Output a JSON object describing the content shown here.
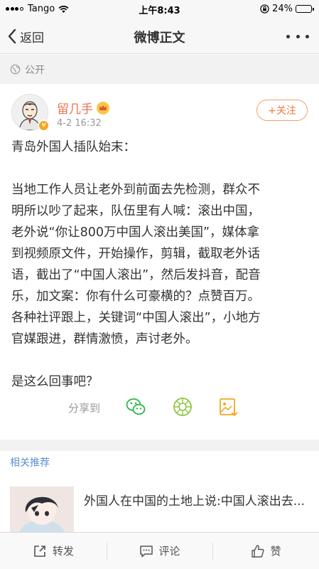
{
  "status_bar": {
    "carrier": "Tango",
    "time": "上午8:43",
    "battery": "24%",
    "battery_level": 0.24
  },
  "nav": {
    "back_label": "返回",
    "title": "微博正文"
  },
  "visibility": "公开",
  "post": {
    "username": "留几手",
    "time": "4-2 16:32",
    "follow_label": "+关注",
    "lines": [
      "青岛外国人插队始末：",
      "",
      "当地工作人员让老外到前面去先检测，群众不",
      "明所以吵了起来，队伍里有人喊：滚出中国，",
      "老外说“你让800万中国人滚出美国”，媒体拿",
      "到视频原文件，开始操作，剪辑，截取老外话",
      "语，截出了“中国人滚出”，然后发抖音，配音",
      "乐，加文案：你有什么可豪横的？点赞百万。",
      "各种社评跟上，关键词“中国人滚出”，小地方",
      "官媒跟进，群情激愤，声讨老外。",
      "",
      "是这么回事吧？"
    ]
  },
  "share": {
    "label": "分享到",
    "targets": [
      "wechat-icon",
      "moments-icon",
      "save-image-icon"
    ]
  },
  "related": {
    "title": "相关推荐",
    "items": [
      {
        "text": "外国人在中国的土地上说:中国人滚出去..."
      }
    ]
  },
  "toolbar": {
    "repost": "转发",
    "comment": "评论",
    "like": "赞"
  },
  "colors": {
    "username": "#eb7350",
    "follow": "#ef7a3a",
    "link": "#5b8fcf",
    "wechat": "#2cb74a",
    "moments": "#8cc63f",
    "save": "#f5a623"
  }
}
